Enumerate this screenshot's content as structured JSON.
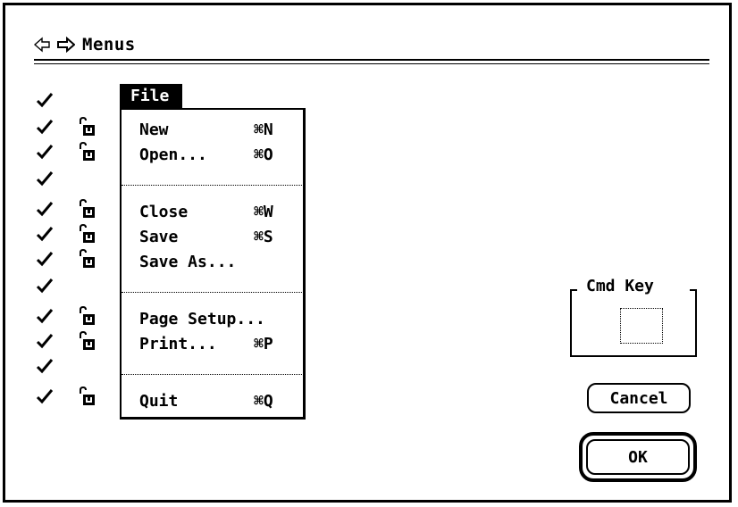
{
  "window": {
    "title": "Menus"
  },
  "menu": {
    "title": "File",
    "items": [
      {
        "label": "New",
        "key": "⌘N"
      },
      {
        "label": "Open...",
        "key": "⌘O"
      },
      {
        "label": "Close",
        "key": "⌘W"
      },
      {
        "label": "Save",
        "key": "⌘S"
      },
      {
        "label": "Save As...",
        "key": ""
      },
      {
        "label": "Page Setup...",
        "key": ""
      },
      {
        "label": "Print...",
        "key": "⌘P"
      },
      {
        "label": "Quit",
        "key": "⌘Q"
      }
    ]
  },
  "panel": {
    "cmd_key_label": "Cmd Key",
    "cmd_key_value": ""
  },
  "buttons": {
    "cancel": "Cancel",
    "ok": "OK"
  }
}
